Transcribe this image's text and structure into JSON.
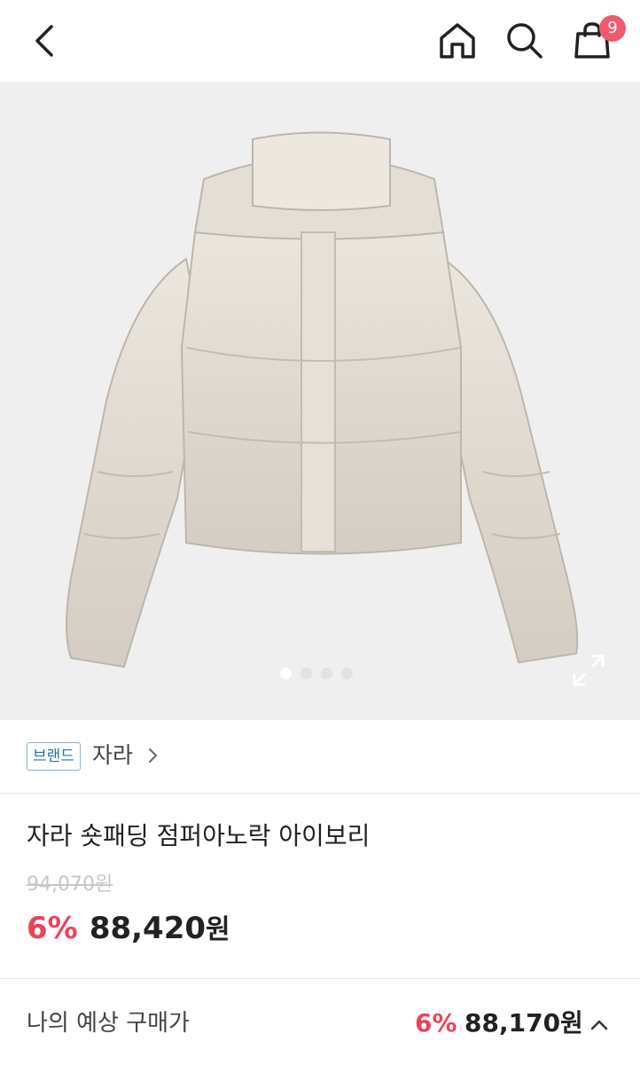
{
  "header": {
    "cart_count": "9",
    "icons": [
      "back-arrow-icon",
      "home-icon",
      "search-icon",
      "shopping-bag-icon"
    ]
  },
  "gallery": {
    "image_subject": "ivory cropped puffer jacket with hood",
    "total_slides": 4,
    "active_slide": 1,
    "expand_icon": "expand-icon"
  },
  "brand": {
    "tag": "브랜드",
    "name": "자라"
  },
  "product": {
    "title": "자라 숏패딩 점퍼아노락 아이보리",
    "original_price": "94,070원",
    "discount_rate": "6%",
    "sale_price": "88,420",
    "currency_unit": "원"
  },
  "expected": {
    "label": "나의 예상 구매가",
    "discount_rate": "6%",
    "price": "88,170원"
  },
  "colors": {
    "accent_red": "#e8445a",
    "badge_red": "#ef5a6f",
    "brand_tag_blue": "#2f6fa6"
  }
}
